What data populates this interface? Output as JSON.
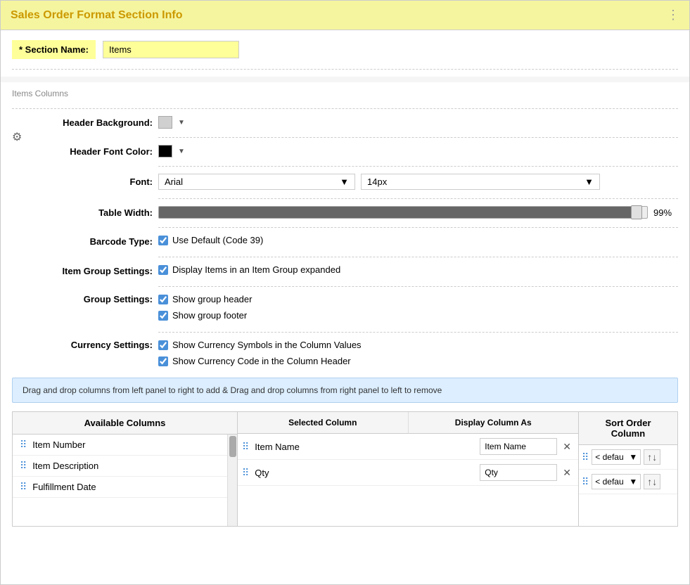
{
  "title": "Sales Order Format Section Info",
  "title_color": "#cc9900",
  "section": {
    "name_label": "* Section Name:",
    "name_value": "Items"
  },
  "items_columns_header": "Items Columns",
  "fields": {
    "header_background_label": "Header Background:",
    "header_background_color": "#d0d0d0",
    "header_font_color_label": "Header Font Color:",
    "header_font_color": "#000000",
    "font_label": "Font:",
    "font_value": "Arial",
    "font_size_value": "14px",
    "table_width_label": "Table Width:",
    "table_width_value": 99,
    "table_width_display": "99%",
    "barcode_type_label": "Barcode Type:",
    "barcode_type_checkbox": true,
    "barcode_type_text": "Use Default (Code 39)",
    "item_group_label": "Item Group Settings:",
    "item_group_checkbox": true,
    "item_group_text": "Display Items in an Item Group expanded",
    "group_settings_label": "Group Settings:",
    "group_header_checkbox": true,
    "group_header_text": "Show group header",
    "group_footer_checkbox": true,
    "group_footer_text": "Show group footer",
    "currency_label": "Currency Settings:",
    "currency_symbols_checkbox": true,
    "currency_symbols_text": "Show Currency Symbols in the Column Values",
    "currency_code_checkbox": true,
    "currency_code_text": "Show Currency Code in the Column Header"
  },
  "dnd_info": "Drag and drop columns from left panel to right to add & Drag and drop columns from right panel to left to remove",
  "available_columns": {
    "header": "Available Columns",
    "items": [
      {
        "label": "Item Number"
      },
      {
        "label": "Item Description"
      },
      {
        "label": "Fulfillment Date"
      }
    ]
  },
  "selected_columns": {
    "header_selected": "Selected Column",
    "header_display": "Display Column As",
    "items": [
      {
        "name": "Item Name",
        "display": "Item Name"
      },
      {
        "name": "Qty",
        "display": "Qty"
      }
    ]
  },
  "sort_order": {
    "header": "Sort Order Column",
    "items": [
      {
        "value": "< defau",
        "order": "↑↓"
      },
      {
        "value": "< defau",
        "order": "↑↓"
      }
    ]
  }
}
